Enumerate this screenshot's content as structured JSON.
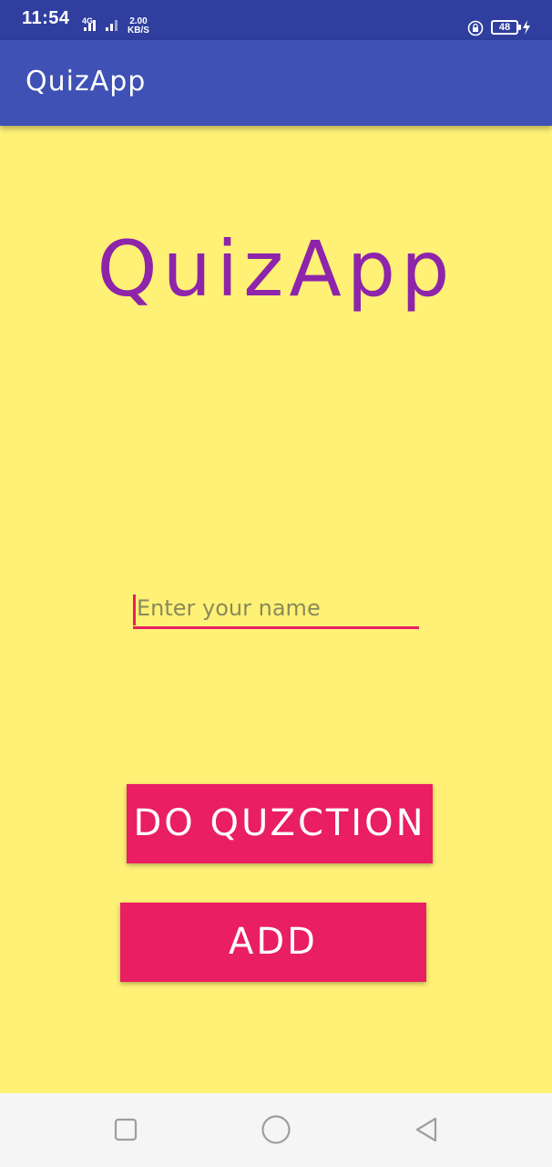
{
  "status_bar": {
    "time": "11:54",
    "network_type": "4G",
    "net_speed_value": "2.00",
    "net_speed_unit": "KB/S",
    "battery_level": "48",
    "icons": [
      "signal-icon",
      "signal-icon",
      "rotation-lock-icon",
      "battery-icon",
      "charging-icon"
    ],
    "background_color": "#303f9f"
  },
  "toolbar": {
    "title": "QuizApp",
    "background_color": "#3f51b5"
  },
  "main": {
    "logo_title": "QuizApp",
    "name_input": {
      "placeholder": "Enter your name",
      "value": ""
    },
    "do_question_button": "DO QUZCTION",
    "add_button": "ADD",
    "background_color": "#fff176",
    "accent_color": "#e91e63",
    "title_color": "#8e24aa"
  },
  "nav_bar": {
    "icons": [
      "recents-icon",
      "home-icon",
      "back-icon"
    ]
  }
}
